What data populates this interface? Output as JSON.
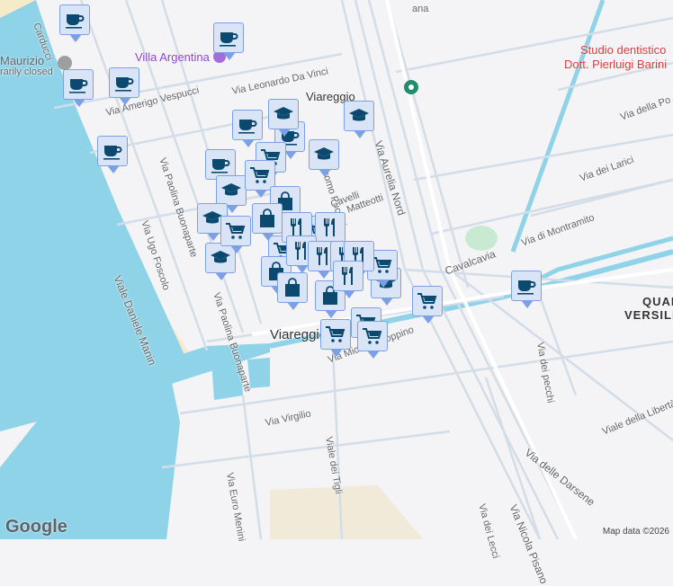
{
  "map": {
    "poi_labels": {
      "villa": "Villa Argentina",
      "maurizio": "Maurizio",
      "maurizio_status": "rarily closed",
      "dentist_1": "Studio dentistico",
      "dentist_2": "Dott. Pierluigi Barini",
      "station": "Viareggio",
      "city": "Viareggio",
      "district_1": "QUARTIE",
      "district_2": "VERSILI"
    },
    "streets": {
      "carducci": "Carducci",
      "vespucci": "Via Amerigo Vespucci",
      "davinci": "Via Leonardo Da Vinci",
      "puccini": "Via Giacomo Puccini",
      "paolina": "Via Paolina Buonaparte",
      "paolina2": "Via Paolina Buonaparte",
      "foscolo": "Via Ugo Foscolo",
      "manin": "Viale Daniele Manin",
      "aurelia": "Via Aurelia Nord",
      "cavalcavia": "Cavalcavia",
      "matteotti": "Matteotti",
      "cavelli": "Cavelli",
      "coppino": "Via Michele Coppino",
      "montramito": "Via di Montramito",
      "larici": "Via dei Larici",
      "dellapo": "Via della Po",
      "pecchi": "Via dei pecchi",
      "liberta": "Viale della Libertà",
      "darsene": "Via delle Darsene",
      "pisano": "Via Nicola Pisano",
      "lecci": "Via dei Lecci",
      "tigli": "Viale dei Tigli",
      "virgilio": "Via Virgilio",
      "menini": "Via Euro Menini",
      "top": "ana"
    },
    "markers": [
      "coffee",
      "school",
      "cart",
      "bag",
      "restaurant"
    ],
    "colors": {
      "water": "#8fd3e8",
      "marker_bg": "#d9e4f7",
      "marker_border": "#7ba0e6",
      "icon": "#0b4a6e",
      "beach": "#f6ebc8"
    }
  },
  "footer": {
    "logo": "Google",
    "credit": "Map data ©2026"
  }
}
